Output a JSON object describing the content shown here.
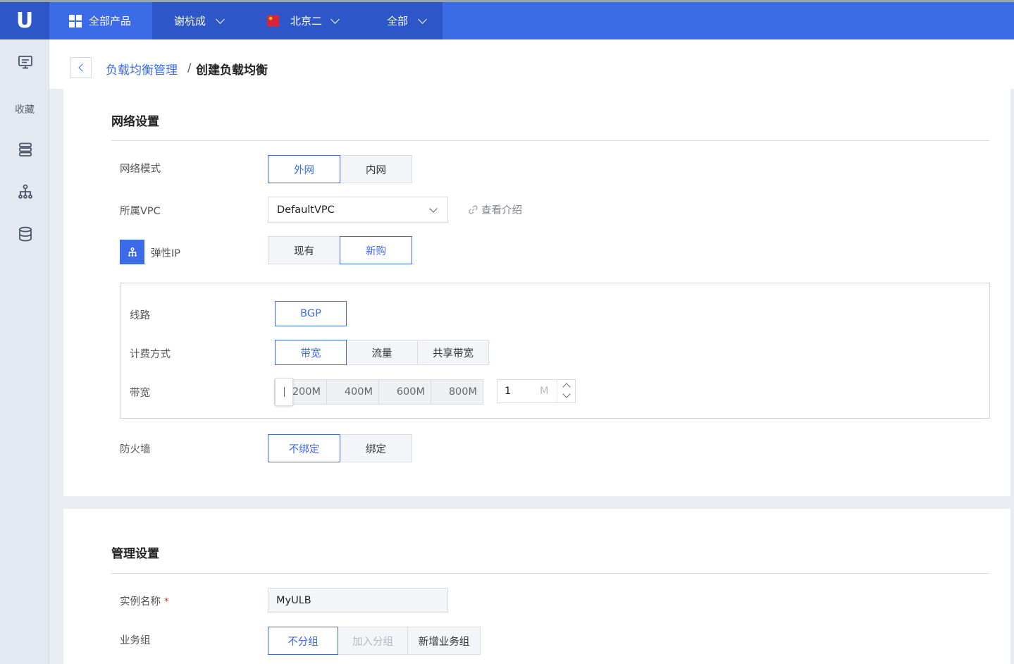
{
  "topbar": {
    "logo": "U",
    "all_products": "全部产品",
    "user": "谢杭成",
    "region": "北京二",
    "scope": "全部"
  },
  "sidebar": {
    "favorites": "收藏",
    "icons": [
      "monitor-icon",
      "server-stack-icon",
      "load-balancer-icon",
      "database-icon"
    ]
  },
  "breadcrumb": {
    "parent": "负载均衡管理",
    "separator": "/",
    "current": "创建负载均衡"
  },
  "network": {
    "title": "网络设置",
    "mode_label": "网络模式",
    "mode_options": [
      "外网",
      "内网"
    ],
    "mode_selected": "外网",
    "vpc_label": "所属VPC",
    "vpc_value": "DefaultVPC",
    "vpc_intro_link": "查看介绍",
    "eip_label": "弹性IP",
    "eip_options": [
      "现有",
      "新购"
    ],
    "eip_selected": "新购",
    "line_label": "线路",
    "line_options": [
      "BGP"
    ],
    "billing_label": "计费方式",
    "billing_options": [
      "带宽",
      "流量",
      "共享带宽"
    ],
    "billing_selected": "带宽",
    "bandwidth_label": "带宽",
    "bandwidth_ticks": [
      "200M",
      "400M",
      "600M",
      "800M"
    ],
    "bandwidth_value": "1",
    "bandwidth_unit": "M",
    "firewall_label": "防火墙",
    "firewall_options": [
      "不绑定",
      "绑定"
    ],
    "firewall_selected": "不绑定"
  },
  "management": {
    "title": "管理设置",
    "name_label": "实例名称",
    "name_required": "*",
    "name_value": "MyULB",
    "group_label": "业务组",
    "group_options": [
      "不分组",
      "加入分组",
      "新增业务组"
    ],
    "group_selected": "不分组",
    "group_disabled": "加入分组"
  },
  "colors": {
    "brand": "#3c6be8",
    "brand_dark": "#2d57c9",
    "required": "#e0393e"
  }
}
